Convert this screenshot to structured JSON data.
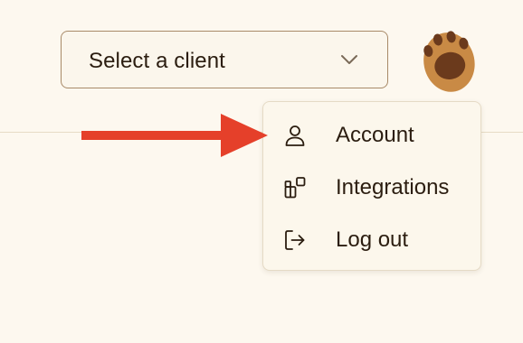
{
  "header": {
    "client_select": {
      "selected_label": "Select a client",
      "icon": "chevron-down-icon"
    },
    "avatar": {
      "icon": "paw-icon",
      "colors": {
        "pad": "#c98a45",
        "toe": "#6b3a1c"
      }
    }
  },
  "user_menu": {
    "items": [
      {
        "label": "Account",
        "icon": "user-icon"
      },
      {
        "label": "Integrations",
        "icon": "integrations-icon"
      },
      {
        "label": "Log out",
        "icon": "log-out-icon"
      }
    ]
  },
  "annotation": {
    "icon": "arrow-right-icon",
    "color": "#e5402a"
  },
  "colors": {
    "background": "#fdf8ef",
    "text": "#2b1d10",
    "border": "#a88a68"
  }
}
